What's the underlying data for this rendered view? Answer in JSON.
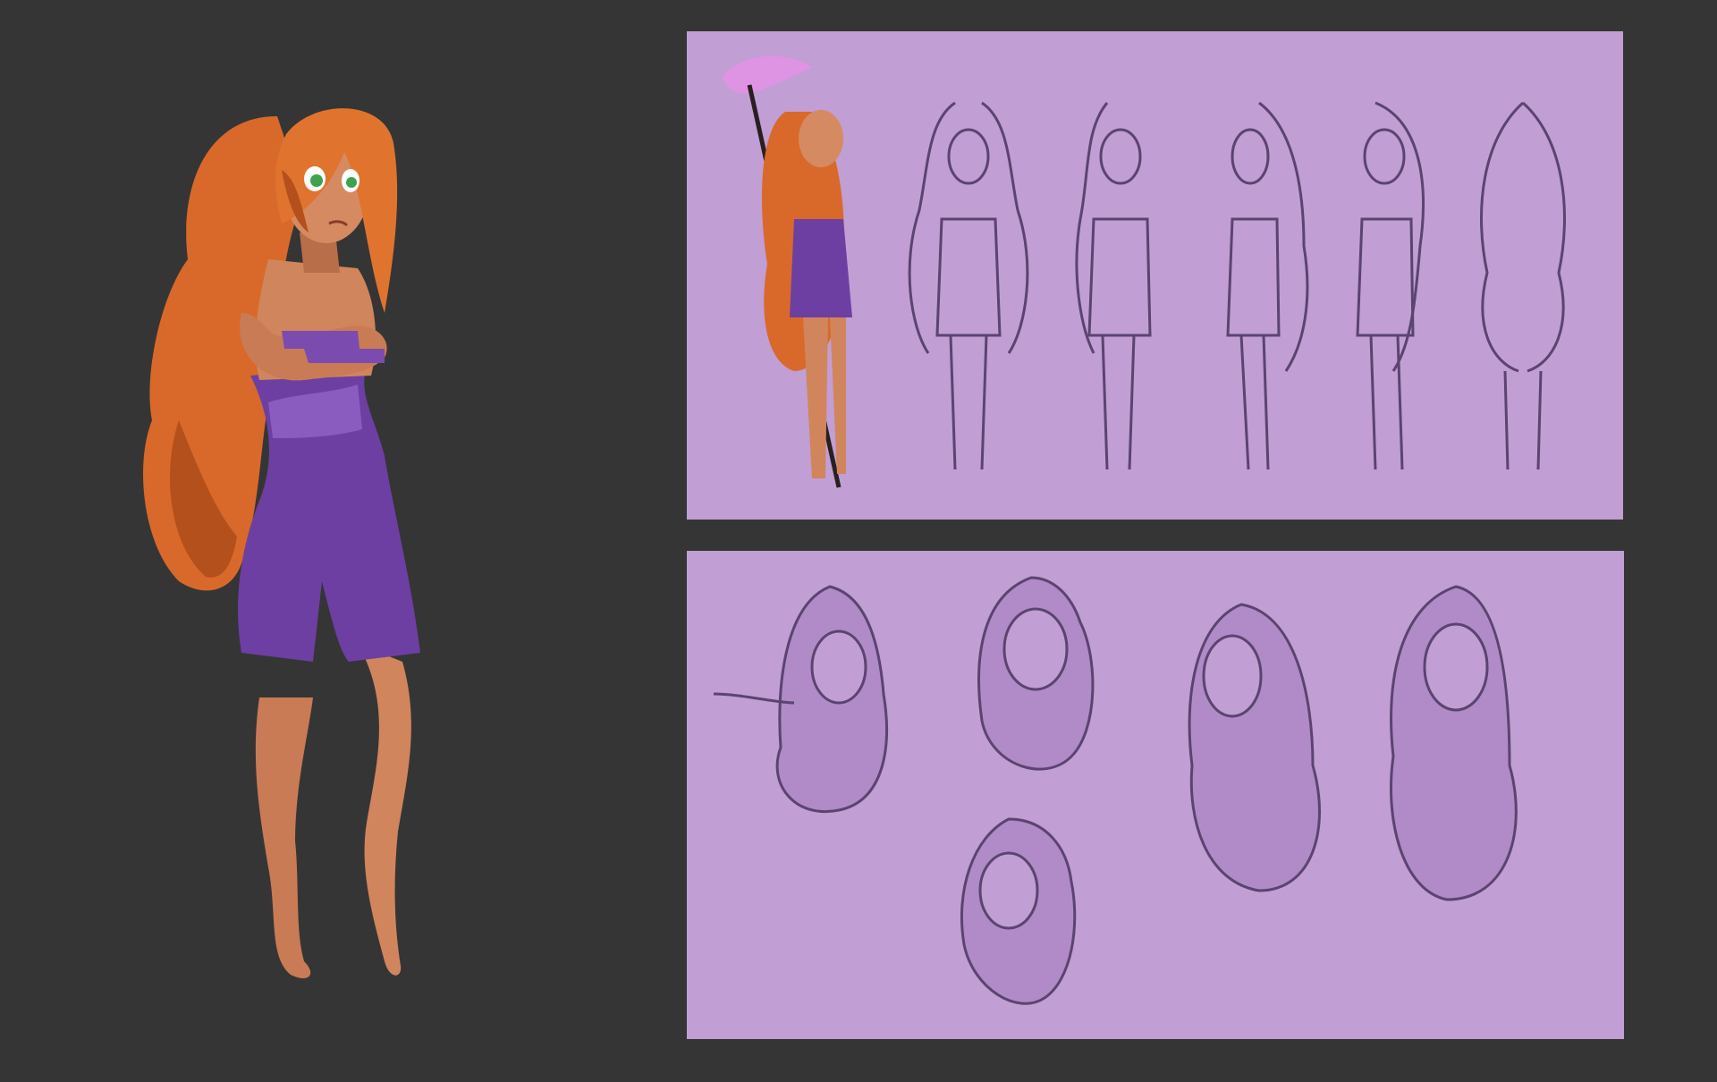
{
  "canvas": {
    "background": "#353535",
    "panel_color": "#c19ed4"
  },
  "colors": {
    "hair": "#d9692a",
    "hair_shadow": "#b4501c",
    "skin": "#d1855d",
    "skin_shadow": "#a9603e",
    "dress": "#6d3fa2",
    "dress_light": "#8a5cc0",
    "eyes": "#3fa24f",
    "sketch_line": "#5b4470",
    "sketch_shade": "#8f74a4",
    "staff_glow": "#e690e6"
  },
  "artwork": {
    "hero": {
      "name": "character-full-color-illustration"
    },
    "turnaround": {
      "name": "character-turnaround-sheet",
      "poses": 6
    },
    "expressions": {
      "name": "character-expression-sketches",
      "heads": 5
    }
  }
}
